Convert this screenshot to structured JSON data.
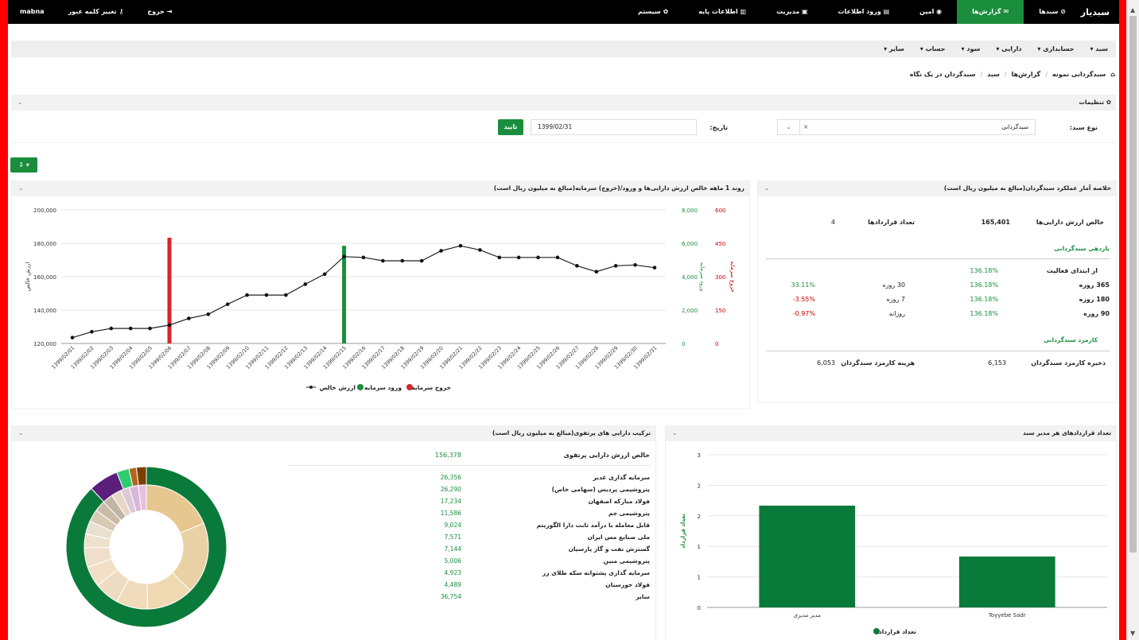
{
  "topbar": {
    "brand": "سبدیار",
    "items": [
      {
        "label": "سبدها",
        "icon": "chart-icon",
        "glyph": "⊘",
        "active": false
      },
      {
        "label": "گزارش‌ها",
        "icon": "report-icon",
        "glyph": "✉",
        "active": true
      },
      {
        "label": "امین",
        "icon": "eye-icon",
        "glyph": "◉",
        "active": false
      },
      {
        "label": "ورود اطلاعات",
        "icon": "file-icon",
        "glyph": "▤",
        "active": false
      },
      {
        "label": "مدیریت",
        "icon": "briefcase-icon",
        "glyph": "▣",
        "active": false
      },
      {
        "label": "اطلاعات پایه",
        "icon": "book-icon",
        "glyph": "▥",
        "active": false
      },
      {
        "label": "سیستم",
        "icon": "gear-icon",
        "glyph": "✿",
        "active": false
      }
    ],
    "right_links": [
      {
        "label": "mabna",
        "icon": "user-icon",
        "glyph": ""
      },
      {
        "label": "تغییر کلمه عبور",
        "icon": "key-icon",
        "glyph": "⚷"
      },
      {
        "label": "خروج",
        "icon": "logout-icon",
        "glyph": "⇥"
      }
    ]
  },
  "menubar": [
    {
      "label": "سبد",
      "caret": "▾"
    },
    {
      "label": "حسابداری",
      "caret": "▾"
    },
    {
      "label": "دارایی",
      "caret": "▾"
    },
    {
      "label": "سود",
      "caret": "▾"
    },
    {
      "label": "حساب",
      "caret": "▾"
    },
    {
      "label": "سایر",
      "caret": "▾"
    }
  ],
  "breadcrumb": {
    "home_glyph": "⌂",
    "items": [
      "سبدگردانی نمونه",
      "گزارش‌ها",
      "سبد",
      "سبدگردان در یک نگاه"
    ],
    "separator": "/"
  },
  "settings": {
    "title": "تنظیمات",
    "gear_glyph": "✿",
    "chevron": "⌄",
    "basket_type_label": "نوع سبد:",
    "basket_type_value": "سبدگردانی",
    "clear_glyph": "×",
    "dropdown_glyph": "⌄",
    "date_label": "تاریخ:",
    "date_value": "1399/02/31",
    "confirm_label": "تایید",
    "export_glyph": "⇩ ▾"
  },
  "summary": {
    "title": "خلاصه آمار عملکرد سبدگردان(مبالغ به میلیون ریال است)",
    "net_asset_label": "خالص ارزش دارایی‌ها",
    "net_asset_value": "165,401",
    "contracts_label": "تعداد قراردادها",
    "contracts_value": "4",
    "returns_title": "بازدهی سبدگردانی",
    "since_start_label": "از ابتدای فعالیت",
    "since_start_value": "136.18%",
    "rows": [
      {
        "label": "365 روزه",
        "value": "136.18%",
        "label2": "30 روزه",
        "value2": "33.11%",
        "color2": "green"
      },
      {
        "label": "180 روزه",
        "value": "136.18%",
        "label2": "7 روزه",
        "value2": "-3.55%",
        "color2": "red"
      },
      {
        "label": "90 روزه",
        "value": "136.18%",
        "label2": "روزانه",
        "value2": "-0.97%",
        "color2": "red"
      }
    ],
    "fee_title": "کارمزد سبدگردانی",
    "fee_reserve_label": "ذخیره کارمزد سبدگردان",
    "fee_reserve_value": "6,153",
    "fee_cost_label": "هزینه کارمزد سبدگردان",
    "fee_cost_value": "6,053"
  },
  "trend": {
    "title": "روند 1 ماهه خالص ارزش دارایی‌ها و ورود/(خروج) سرمایه(مبالغ به میلیون ریال است)",
    "legend": {
      "net": "ارزش خالص",
      "in": "ورود سرمایه",
      "out": "خروج سرمایه"
    },
    "colors": {
      "net": "#000000",
      "in": "#1a8e3d",
      "out": "#d9262a"
    }
  },
  "composition": {
    "title": "ترکیب دارایی های پرتفوی(مبالغ به میلیون ریال است)",
    "total_label": "خالص ارزش دارایی پرتفوی",
    "total_value": "156,378",
    "items": [
      {
        "name": "سرمایه گذاری غدیر",
        "value": "26,356"
      },
      {
        "name": "پتروشیمی پردیس (سهامی خاص)",
        "value": "26,290"
      },
      {
        "name": "فولاد مبارکه اصفهان",
        "value": "17,234"
      },
      {
        "name": "پتروشیمی جم",
        "value": "11,586"
      },
      {
        "name": "قابل معامله با درآمد ثابت دارا الگوریتم",
        "value": "9,024"
      },
      {
        "name": "ملی صنایع مس ایران",
        "value": "7,571"
      },
      {
        "name": "گسترش نفت و گاز پارسیان",
        "value": "7,144"
      },
      {
        "name": "پتروشیمی مبین",
        "value": "5,006"
      },
      {
        "name": "سرمایه گذاری پشتوانه سکه طلای زر",
        "value": "4,923"
      },
      {
        "name": "فولاد خوزستان",
        "value": "4,489"
      },
      {
        "name": "سایر",
        "value": "36,754"
      }
    ]
  },
  "contracts_panel": {
    "title": "تعداد قراردادهای هر مدیر سبد",
    "legend": "تعداد قرارداد"
  },
  "chart_data": [
    {
      "type": "line",
      "x": [
        "1399/02/01",
        "1399/02/02",
        "1399/02/03",
        "1399/02/04",
        "1399/02/05",
        "1399/02/06",
        "1399/02/07",
        "1399/02/08",
        "1399/02/09",
        "1399/02/10",
        "1399/02/11",
        "1399/02/12",
        "1399/02/13",
        "1399/02/14",
        "1399/02/15",
        "1399/02/16",
        "1399/02/17",
        "1399/02/18",
        "1399/02/19",
        "1399/02/20",
        "1399/02/21",
        "1399/02/22",
        "1399/02/23",
        "1399/02/24",
        "1399/02/25",
        "1399/02/26",
        "1399/02/27",
        "1399/02/28",
        "1399/02/29",
        "1399/02/30",
        "1399/02/31"
      ],
      "series": [
        {
          "name": "ارزش خالص",
          "axis": "left",
          "values": [
            123500,
            127000,
            129000,
            129000,
            129000,
            131000,
            135000,
            137500,
            143500,
            149000,
            149000,
            149000,
            155500,
            161500,
            172000,
            171500,
            169500,
            169500,
            169500,
            175500,
            178500,
            176000,
            171500,
            171500,
            171500,
            171500,
            166500,
            163000,
            166500,
            167000,
            165400
          ]
        },
        {
          "name": "ورود سرمایه",
          "axis": "right1",
          "values": [
            0,
            0,
            0,
            0,
            0,
            0,
            0,
            0,
            0,
            0,
            0,
            0,
            0,
            0,
            5850,
            0,
            0,
            0,
            0,
            0,
            0,
            0,
            0,
            0,
            0,
            0,
            0,
            0,
            0,
            0,
            0
          ]
        },
        {
          "name": "خروج سرمایه",
          "axis": "right2",
          "values": [
            0,
            0,
            0,
            0,
            0,
            475,
            0,
            0,
            0,
            0,
            0,
            0,
            0,
            0,
            0,
            0,
            0,
            0,
            0,
            0,
            0,
            0,
            0,
            0,
            0,
            0,
            0,
            0,
            0,
            0,
            0
          ]
        }
      ],
      "ylabel": "ارزش خالص",
      "ylabel_right1": "ورود سرمایه",
      "ylabel_right2": "خروج سرمایه",
      "ylim": [
        120000,
        200000
      ],
      "yticks": [
        "120,000",
        "140,000",
        "160,000",
        "180,000",
        "200,000"
      ],
      "ylim_right1": [
        0,
        8000
      ],
      "yticks_right1": [
        "0",
        "2,000",
        "4,000",
        "6,000",
        "8,000"
      ],
      "ylim_right2": [
        0,
        600
      ],
      "yticks_right2": [
        "0",
        "150",
        "300",
        "450",
        "600"
      ],
      "grid": true,
      "legend_position": "bottom"
    },
    {
      "type": "pie",
      "title": "ترکیب دارایی های پرتفوی",
      "outer": [
        {
          "value": 88,
          "color": "#0a7a3a"
        },
        {
          "value": 6,
          "color": "#5b1e7d"
        },
        {
          "value": 2.5,
          "color": "#2ecc71"
        },
        {
          "value": 1.5,
          "color": "#b5651d"
        },
        {
          "value": 2,
          "color": "#7b3f00"
        }
      ],
      "inner": [
        {
          "value": 26356,
          "color": "#e6c78f"
        },
        {
          "value": 26290,
          "color": "#ead1a5"
        },
        {
          "value": 17234,
          "color": "#eed9b3"
        },
        {
          "value": 11586,
          "color": "#f0dcbc"
        },
        {
          "value": 9024,
          "color": "#eedcc2"
        },
        {
          "value": 7571,
          "color": "#f1e0c6"
        },
        {
          "value": 7144,
          "color": "#efdec9"
        },
        {
          "value": 5006,
          "color": "#ede0cc"
        },
        {
          "value": 4923,
          "color": "#e9e0d0"
        },
        {
          "value": 4489,
          "color": "#d8c9b3"
        },
        {
          "value": 4000,
          "color": "#c9bba6"
        },
        {
          "value": 3800,
          "color": "#bfb6a6"
        },
        {
          "value": 3600,
          "color": "#e8d5c5"
        },
        {
          "value": 3400,
          "color": "#ddc8d8"
        },
        {
          "value": 3200,
          "color": "#d8b8d8"
        },
        {
          "value": 3000,
          "color": "#e6c0e0"
        }
      ]
    },
    {
      "type": "bar",
      "categories": [
        "مدیر مدیری",
        "Toyyebe Sadr"
      ],
      "series": [
        {
          "name": "تعداد قرارداد",
          "values": [
            2,
            1
          ]
        }
      ],
      "ylabel": "تعداد قرارداد",
      "ylim": [
        0,
        3
      ],
      "yticks": [
        "0",
        "1",
        "1",
        "2",
        "2",
        "3"
      ],
      "color": "#0a7a3a",
      "grid": true,
      "legend_position": "bottom"
    }
  ]
}
